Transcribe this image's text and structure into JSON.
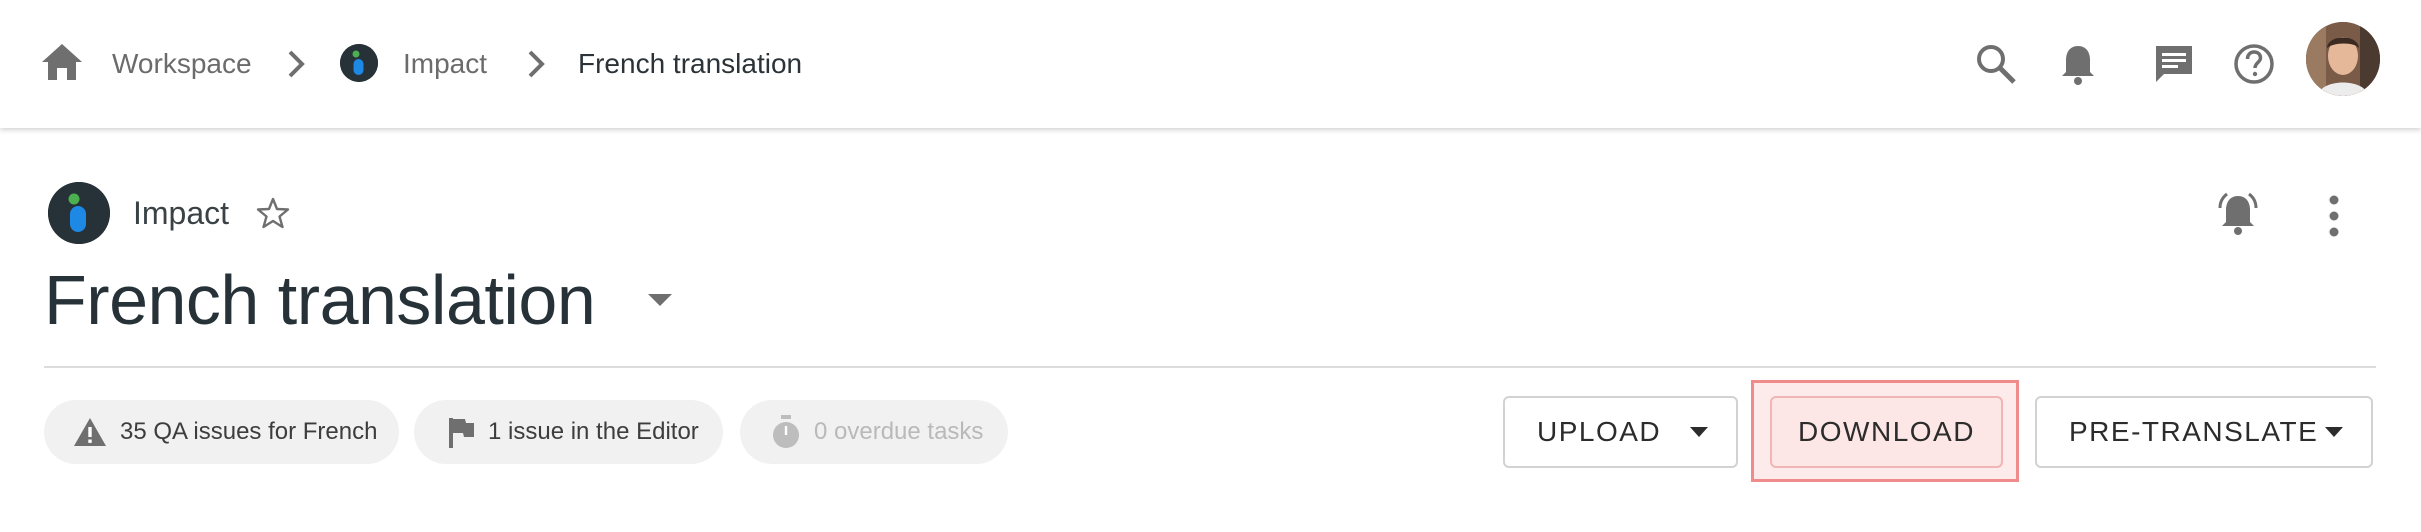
{
  "breadcrumb": {
    "home_icon": "home-icon",
    "items": [
      {
        "label": "Workspace"
      },
      {
        "label": "Impact"
      },
      {
        "label": "French translation"
      }
    ]
  },
  "topbar_actions": {
    "icons": [
      "search-icon",
      "bell-icon",
      "chat-icon",
      "help-icon"
    ],
    "avatar": "user-avatar"
  },
  "project": {
    "name": "Impact",
    "logo_colors": {
      "background": "#263238",
      "dot": "#4caf50",
      "stem": "#1e88e5"
    }
  },
  "page": {
    "title": "French translation"
  },
  "chips": [
    {
      "icon": "warning-icon",
      "label": "35 QA issues for French",
      "disabled": false
    },
    {
      "icon": "flag-icon",
      "label": "1 issue in the Editor",
      "disabled": false
    },
    {
      "icon": "timer-icon",
      "label": "0 overdue tasks",
      "disabled": true
    }
  ],
  "actions": {
    "upload_label": "UPLOAD",
    "download_label": "DOWNLOAD",
    "pretranslate_label": "PRE-TRANSLATE",
    "highlight_color": "#ef8b8b"
  }
}
